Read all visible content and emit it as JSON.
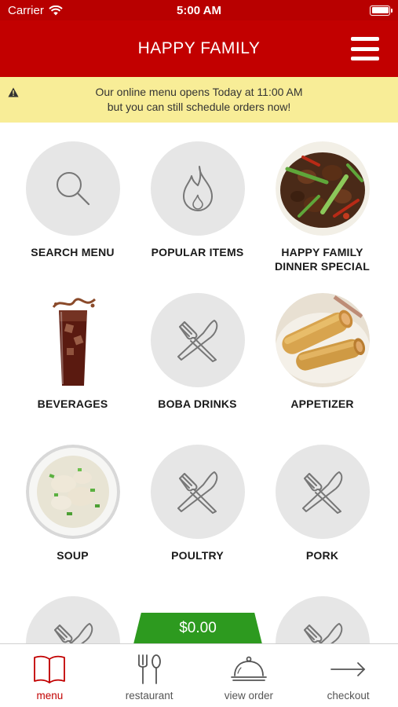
{
  "status_bar": {
    "carrier": "Carrier",
    "time": "5:00 AM"
  },
  "header": {
    "title": "HAPPY FAMILY"
  },
  "banner": {
    "line1": "Our online menu opens Today at 11:00 AM",
    "line2": "but you can still schedule orders now!"
  },
  "categories": [
    {
      "label": "SEARCH MENU",
      "icon": "search-icon"
    },
    {
      "label": "POPULAR ITEMS",
      "icon": "flame-icon"
    },
    {
      "label_line1": "HAPPY FAMILY",
      "label_line2": "DINNER SPECIAL",
      "icon": "stir-fry-photo"
    },
    {
      "label": "BEVERAGES",
      "icon": "cola-glass-photo"
    },
    {
      "label": "BOBA DRINKS",
      "icon": "fork-knife-icon"
    },
    {
      "label": "APPETIZER",
      "icon": "egg-roll-photo"
    },
    {
      "label": "SOUP",
      "icon": "wonton-soup-photo"
    },
    {
      "label": "POULTRY",
      "icon": "fork-knife-icon"
    },
    {
      "label": "PORK",
      "icon": "fork-knife-icon"
    }
  ],
  "cart": {
    "total": "$0.00"
  },
  "tabs": [
    {
      "label": "menu",
      "icon": "book-icon"
    },
    {
      "label": "restaurant",
      "icon": "utensils-icon"
    },
    {
      "label": "view order",
      "icon": "cloche-icon"
    },
    {
      "label": "checkout",
      "icon": "arrow-right-icon"
    }
  ],
  "colors": {
    "header_red": "#c20000",
    "banner_yellow": "#f8ed97",
    "cart_green": "#2d9a1f",
    "tile_gray": "#e6e6e6"
  }
}
